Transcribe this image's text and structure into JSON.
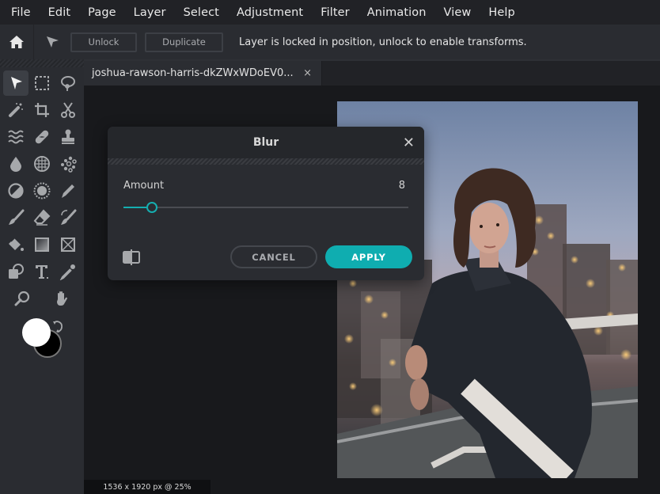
{
  "menubar": {
    "items": [
      "File",
      "Edit",
      "Page",
      "Layer",
      "Select",
      "Adjustment",
      "Filter",
      "Animation",
      "View",
      "Help"
    ]
  },
  "toolbar": {
    "home_icon": "home-icon",
    "move_icon": "arrow-pointer-icon",
    "unlock_label": "Unlock",
    "duplicate_label": "Duplicate",
    "message": "Layer is locked in position, unlock to enable transforms."
  },
  "tools": [
    {
      "name": "move-tool",
      "icon": "arrow-pointer-icon",
      "active": true
    },
    {
      "name": "marquee-tool",
      "icon": "dashed-rectangle-icon"
    },
    {
      "name": "lasso-tool",
      "icon": "lasso-icon"
    },
    {
      "name": "magic-wand-tool",
      "icon": "magic-wand-icon"
    },
    {
      "name": "crop-tool",
      "icon": "crop-icon"
    },
    {
      "name": "cut-tool",
      "icon": "scissors-icon"
    },
    {
      "name": "liquify-tool",
      "icon": "waves-icon"
    },
    {
      "name": "heal-tool",
      "icon": "bandage-icon"
    },
    {
      "name": "clone-stamp-tool",
      "icon": "stamp-icon"
    },
    {
      "name": "blur-tool",
      "icon": "drop-icon"
    },
    {
      "name": "sponge-tool",
      "icon": "grid-circle-icon"
    },
    {
      "name": "pixelate-tool",
      "icon": "dots-icon"
    },
    {
      "name": "dodge-burn-tool",
      "icon": "half-circle-icon"
    },
    {
      "name": "sharpen-tool",
      "icon": "sun-icon"
    },
    {
      "name": "pen-tool",
      "icon": "pen-icon"
    },
    {
      "name": "brush-tool",
      "icon": "brush-icon"
    },
    {
      "name": "eraser-tool",
      "icon": "eraser-icon"
    },
    {
      "name": "color-replace-tool",
      "icon": "brush-swap-icon"
    },
    {
      "name": "paint-bucket-tool",
      "icon": "bucket-icon"
    },
    {
      "name": "gradient-tool",
      "icon": "gradient-icon"
    },
    {
      "name": "shape-frame-tool",
      "icon": "frame-icon"
    },
    {
      "name": "shape-tool",
      "icon": "shapes-icon"
    },
    {
      "name": "text-tool",
      "icon": "text-icon"
    },
    {
      "name": "eyedropper-tool",
      "icon": "eyedropper-icon"
    },
    {
      "name": "zoom-tool",
      "icon": "magnifier-icon"
    },
    {
      "name": "hand-tool",
      "icon": "hand-icon"
    }
  ],
  "colors": {
    "foreground": "#ffffff",
    "background": "#000000",
    "accent": "#0fadb0"
  },
  "tab": {
    "label": "joshua-rawson-harris-dkZWxWDoEV0...",
    "close": "×"
  },
  "status": {
    "text": "1536 x 1920 px @ 25%"
  },
  "dialog": {
    "title": "Blur",
    "close": "✕",
    "amount_label": "Amount",
    "amount_value": "8",
    "slider_fraction": 0.1,
    "compare_icon": "split-compare-icon",
    "cancel_label": "CANCEL",
    "apply_label": "APPLY"
  }
}
